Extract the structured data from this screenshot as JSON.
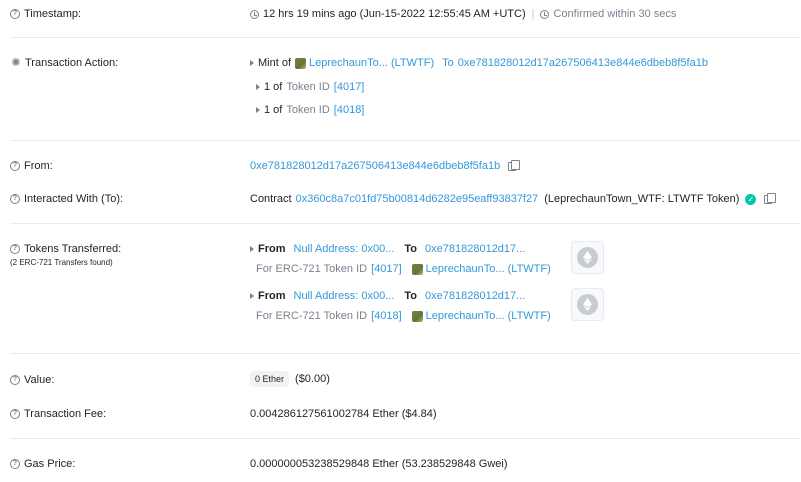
{
  "timestamp": {
    "label": "Timestamp:",
    "value": "12 hrs 19 mins ago (Jun-15-2022 12:55:45 AM +UTC)",
    "separator": "|",
    "confirmed": "Confirmed within 30 secs"
  },
  "action": {
    "label": "Transaction Action:",
    "mint_prefix": "Mint of",
    "token_name": "LeprechaunTo... (LTWTF)",
    "to_word": "To",
    "to_address": "0xe781828012d17a267506413e844e6dbeb8f5fa1b",
    "items": [
      {
        "qty": "1 of",
        "token_word": "Token ID",
        "id": "[4017]"
      },
      {
        "qty": "1 of",
        "token_word": "Token ID",
        "id": "[4018]"
      }
    ]
  },
  "from": {
    "label": "From:",
    "address": "0xe781828012d17a267506413e844e6dbeb8f5fa1b"
  },
  "interacted": {
    "label": "Interacted With (To):",
    "prefix": "Contract",
    "address": "0x360c8a7c01fd75b00814d6282e95eaff93837f27",
    "name": "(LeprechaunTown_WTF: LTWTF Token)"
  },
  "tokens": {
    "label": "Tokens Transferred:",
    "sublabel": "(2 ERC-721 Transfers found)",
    "transfers": [
      {
        "from_word": "From",
        "from": "Null Address: 0x00...",
        "to_word": "To",
        "to": "0xe781828012d17...",
        "for_text": "For ERC-721 Token ID",
        "id": "[4017]",
        "token": "LeprechaunTo... (LTWTF)"
      },
      {
        "from_word": "From",
        "from": "Null Address: 0x00...",
        "to_word": "To",
        "to": "0xe781828012d17...",
        "for_text": "For ERC-721 Token ID",
        "id": "[4018]",
        "token": "LeprechaunTo... (LTWTF)"
      }
    ]
  },
  "value": {
    "label": "Value:",
    "amount": "0 Ether",
    "usd": "($0.00)"
  },
  "fee": {
    "label": "Transaction Fee:",
    "value": "0.004286127561002784 Ether ($4.84)"
  },
  "gas": {
    "label": "Gas Price:",
    "value": "0.000000053238529848 Ether (53.238529848 Gwei)"
  },
  "colors": {
    "link": "#3498db",
    "muted": "#77838f",
    "success": "#00c9a7",
    "divider": "#e7eaf3"
  }
}
